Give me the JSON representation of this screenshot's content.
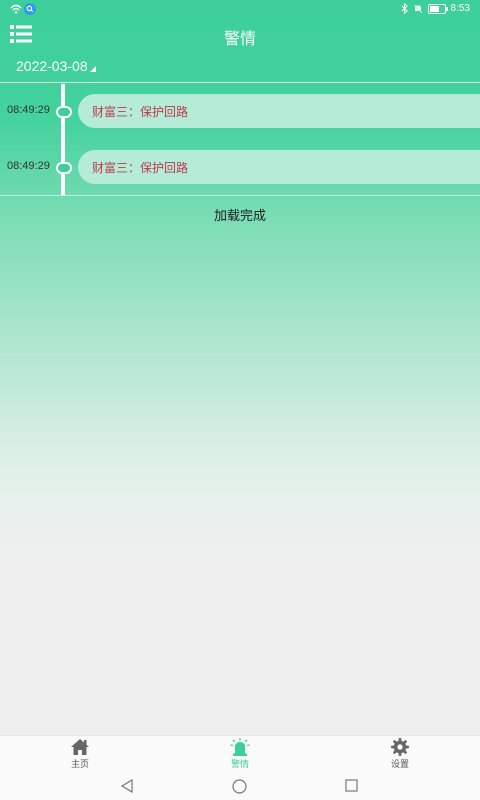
{
  "status": {
    "time": "8:53",
    "icons": [
      "wifi-icon",
      "search-badge-icon",
      "bluetooth-icon",
      "mute-icon",
      "battery-icon"
    ]
  },
  "header": {
    "title": "警情",
    "menu_icon": "list-icon"
  },
  "filter": {
    "date": "2022-03-08"
  },
  "alarms": [
    {
      "time": "08:49:29",
      "text": "财富三：保护回路"
    },
    {
      "time": "08:49:29",
      "text": "财富三：保护回路"
    }
  ],
  "list_footer": "加载完成",
  "tabs": [
    {
      "label": "主页",
      "icon": "home-icon",
      "active": false
    },
    {
      "label": "警情",
      "icon": "siren-icon",
      "active": true
    },
    {
      "label": "设置",
      "icon": "gear-icon",
      "active": false
    }
  ],
  "colors": {
    "primary": "#3dcf9a",
    "alarm_text": "#c0394b",
    "card_bg": "#b4ecd8",
    "tab_inactive": "#555555"
  }
}
